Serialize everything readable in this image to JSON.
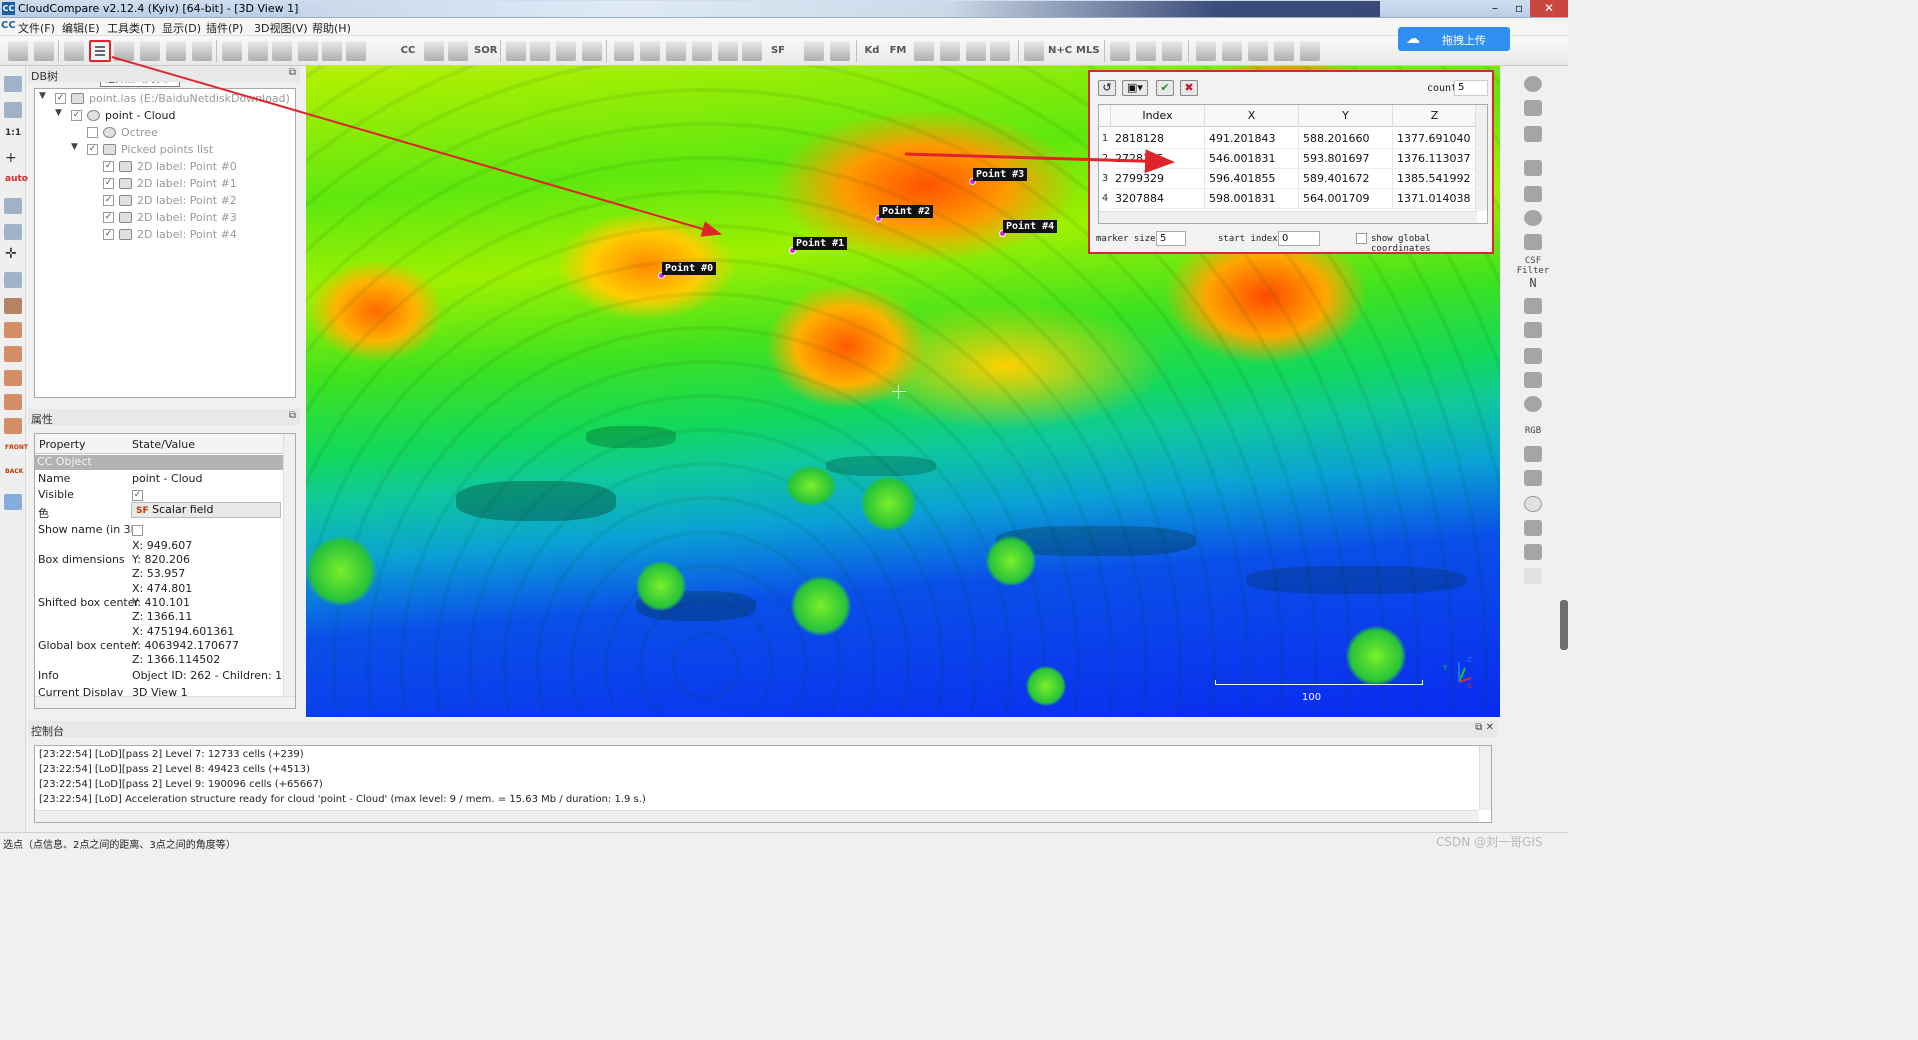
{
  "window": {
    "title": "CloudCompare v2.12.4 (Kyiv) [64-bit] - [3D View 1]",
    "app_icon": "CC"
  },
  "menu": {
    "logo": "CC",
    "items": [
      "文件(F)",
      "编辑(E)",
      "工具类(T)",
      "显示(D)",
      "插件(P)",
      "3D视图(V)",
      "帮助(H)"
    ]
  },
  "toolbar": {
    "tooltip": "选择点（列表）",
    "sor_label": "SOR",
    "sf_label": "SF",
    "nc_label": "N+C",
    "mls_label": "MLS",
    "kd_label": "Kd",
    "fm_label": "FM",
    "cc_label": "CC",
    "upload_label": "拖拽上传",
    "upload_icon": "cloud-upload-icon"
  },
  "left_tools": {
    "one_to_one": "1:1",
    "auto": "auto",
    "front": "FRONT",
    "back": "BACK"
  },
  "db_tree": {
    "title": "DB树",
    "root": "point.las (E:/BaiduNetdiskDownload)",
    "cloud": "point - Cloud",
    "octree": "Octree",
    "picked_list": "Picked points list",
    "labels": [
      "2D label: Point #0",
      "2D label: Point #1",
      "2D label: Point #2",
      "2D label: Point #3",
      "2D label: Point #4"
    ]
  },
  "properties": {
    "title": "属性",
    "col_property": "Property",
    "col_value": "State/Value",
    "section": "CC Object",
    "name_key": "Name",
    "name_val": "point - Cloud",
    "visible_key": "Visible",
    "color_key": "色",
    "color_val": "Scalar field",
    "showname_key": "Show name (in 3D)",
    "box_dims_key": "Box dimensions",
    "box_dims": [
      "X: 949.607",
      "Y: 820.206",
      "Z: 53.957"
    ],
    "shifted_key": "Shifted box center",
    "shifted": [
      "X: 474.801",
      "Y: 410.101",
      "Z: 1366.11"
    ],
    "global_key": "Global box center",
    "global": [
      "X: 475194.601361",
      "Y: 4063942.170677",
      "Z: 1366.114502"
    ],
    "info_key": "Info",
    "info_val": "Object ID: 262 - Children: 1",
    "display_key": "Current Display",
    "display_val": "3D View 1"
  },
  "view3d": {
    "points": [
      "Point #0",
      "Point #1",
      "Point #2",
      "Point #3",
      "Point #4"
    ],
    "scale_label": "100",
    "axis_labels": {
      "x": "X",
      "y": "Y",
      "z": "Z"
    }
  },
  "point_list": {
    "count_label": "count",
    "count_value": "5",
    "columns": [
      "Index",
      "X",
      "Y",
      "Z"
    ],
    "rows": [
      {
        "n": "1",
        "index": "2818128",
        "x": "491.201843",
        "y": "588.201660",
        "z": "1377.691040"
      },
      {
        "n": "2",
        "index": "2728195",
        "x": "546.001831",
        "y": "593.801697",
        "z": "1376.113037"
      },
      {
        "n": "3",
        "index": "2799329",
        "x": "596.401855",
        "y": "589.401672",
        "z": "1385.541992"
      },
      {
        "n": "4",
        "index": "3207884",
        "x": "598.001831",
        "y": "564.001709",
        "z": "1371.014038"
      }
    ],
    "marker_size_label": "marker size",
    "marker_size_value": "5",
    "start_index_label": "start index",
    "start_index_value": "0",
    "show_global_label": "show global coordinates"
  },
  "right_tools": {
    "csf_filter": "CSF Filter",
    "n_label": "N",
    "rgb_label": "RGB"
  },
  "console": {
    "title": "控制台",
    "lines": [
      "[23:22:54] [LoD][pass 2] Level 7: 12733 cells (+239)",
      "[23:22:54] [LoD][pass 2] Level 8: 49423 cells (+4513)",
      "[23:22:54] [LoD][pass 2] Level 9: 190096 cells (+65667)",
      "[23:22:54] [LoD] Acceleration structure ready for cloud 'point - Cloud' (max level: 9 / mem. = 15.63 Mb / duration: 1.9 s.)"
    ]
  },
  "status": {
    "message": "选点（点信息、2点之间的距离、3点之间的角度等）",
    "watermark": "CSDN @刘一哥GIS"
  },
  "colors": {
    "highlight_red": "#e0242b",
    "upload_blue": "#2f8ff2",
    "point_magenta": "#e020e0"
  }
}
